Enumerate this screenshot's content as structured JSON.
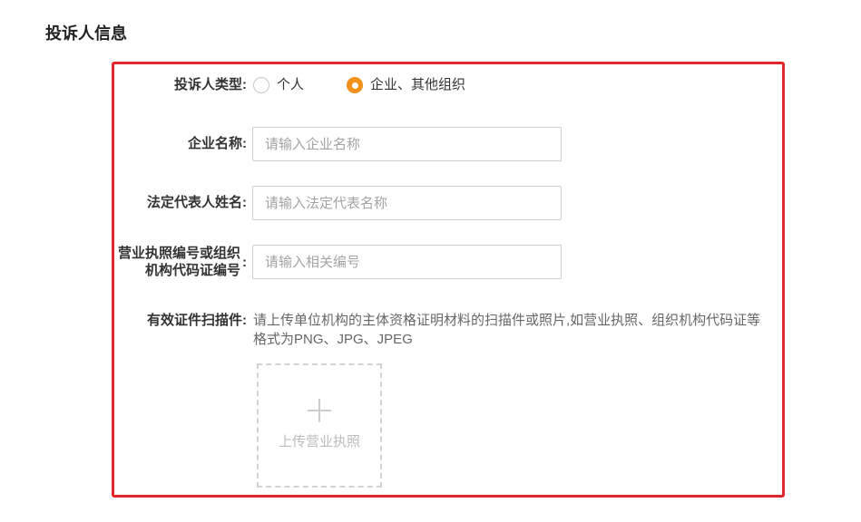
{
  "section": {
    "title": "投诉人信息"
  },
  "colors": {
    "accent": "#f39019",
    "highlight": "#e3262b"
  },
  "form": {
    "label_suffix": ":",
    "complainant_type": {
      "label": "投诉人类型",
      "options": [
        {
          "label": "个人",
          "checked": false
        },
        {
          "label": "企业、其他组织",
          "checked": true
        }
      ]
    },
    "company_name": {
      "label": "企业名称",
      "placeholder": "请输入企业名称",
      "value": ""
    },
    "legal_representative": {
      "label": "法定代表人姓名",
      "placeholder": "请输入法定代表名称",
      "value": ""
    },
    "license_number": {
      "label_lines": [
        "营业执照编号或组织",
        "机构代码证编号"
      ],
      "placeholder": "请输入相关编号",
      "value": ""
    },
    "certificate_scan": {
      "label": "有效证件扫描件",
      "hint_lines": [
        "请上传单位机构的主体资格证明材料的扫描件或照片,如营业执照、组织机构代码证等",
        "格式为PNG、JPG、JPEG"
      ],
      "upload_label": "上传营业执照"
    }
  }
}
